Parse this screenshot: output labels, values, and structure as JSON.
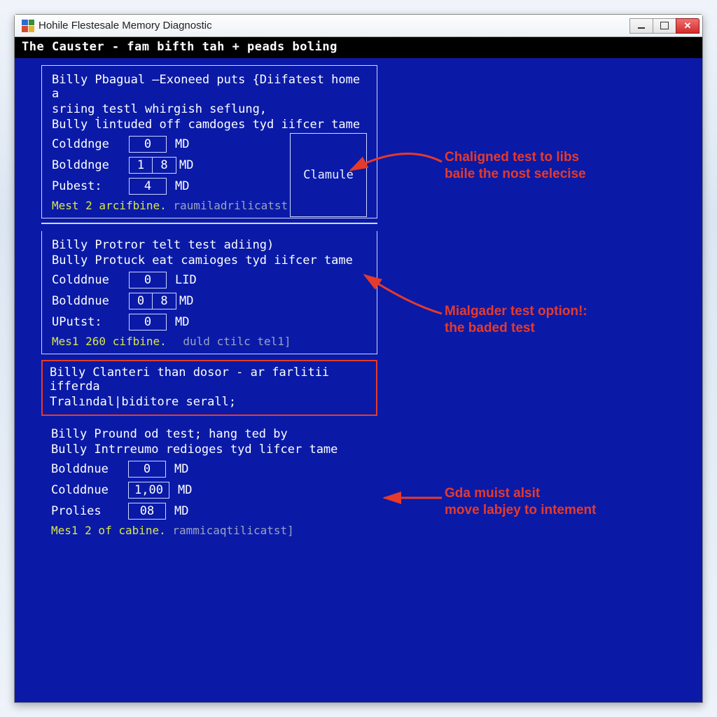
{
  "window": {
    "title": "Hohile Flestesale Memory Diagnostic"
  },
  "header_bar": "The Causter - fam bifth tah + peads boling",
  "clam_button": "Clamule",
  "panels": [
    {
      "line1": "Billy Pbagual –Exoneed puts {Diifatest home a",
      "line2": "sriing testl whirgish seflung,",
      "line3": "Bully l̇intuded off camdoges tyd iifcer tame",
      "rows": [
        {
          "label": "Colddnge",
          "value_a": "0",
          "value_b": "",
          "unit": "MD"
        },
        {
          "label": "Bolddnge",
          "value_a": "1",
          "value_b": "8",
          "unit": "MD"
        },
        {
          "label": "Pubest:",
          "value_a": "4",
          "value_b": "",
          "unit": "MD"
        }
      ],
      "status_a": "Mest 2 arcifbine.",
      "status_b": "raumiladrilicatst"
    },
    {
      "line1": "Billy Protror telt test adiing)",
      "line2": "",
      "line3": "Bully Protuck eat camioges tyd iifcer tame",
      "rows": [
        {
          "label": "Colddnue",
          "value_a": "0",
          "value_b": "",
          "unit": "LID"
        },
        {
          "label": "Bolddnue",
          "value_a": "0",
          "value_b": "8",
          "unit": "MD"
        },
        {
          "label": "UPutst:",
          "value_a": "0",
          "value_b": "",
          "unit": "MD"
        }
      ],
      "status_a": "Mes1 260 cifbine.",
      "status_b": "duld ctilc tel1]"
    },
    {
      "line1": "Billy Clanteri than dosor - ar farlitii ifferda",
      "line2": "Tralındal|biditore serall;",
      "line3": "",
      "rows": [],
      "status_a": "",
      "status_b": ""
    },
    {
      "line1": "Billy Pround od test; hang ted by",
      "line2": "",
      "line3": "Bully Intrreumo redioges tyd lifcer tame",
      "rows": [
        {
          "label": "Bolddnue",
          "value_a": "0",
          "value_b": "",
          "unit": "MD"
        },
        {
          "label": "Colddnue",
          "value_a": "1,00",
          "value_b": "",
          "unit": "MD"
        },
        {
          "label": "Prolies",
          "value_a": "08",
          "value_b": "",
          "unit": "MD"
        }
      ],
      "status_a": "Mes1 2 of cabine.",
      "status_b": "rammicaqtilicatst]"
    }
  ],
  "annotations": [
    {
      "line1": "Chaligned test to libs",
      "line2": "baile the nost selecise"
    },
    {
      "line1": "Mialgader test option!:",
      "line2": "the baded test"
    },
    {
      "line1": "Gda muist alsit",
      "line2": "move labjey to intement"
    }
  ],
  "colors": {
    "bg": "#0a1aa7",
    "accent": "#e63a2a",
    "status": "#d8e64a"
  }
}
